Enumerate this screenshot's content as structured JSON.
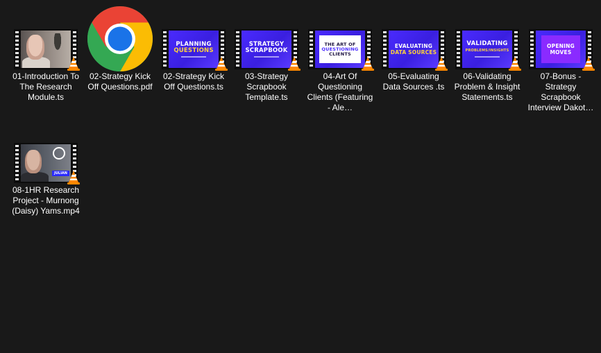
{
  "files": [
    {
      "label": "01-Introduction To The Research Module.ts"
    },
    {
      "label": "02-Strategy Kick Off Questions.pdf"
    },
    {
      "label": "02-Strategy Kick Off Questions.ts",
      "thumb_a": "PLANNING",
      "thumb_b": "QUESTIONS"
    },
    {
      "label": "03-Strategy Scrapbook Template.ts",
      "thumb_a": "STRATEGY",
      "thumb_b": "SCRAPBOOK"
    },
    {
      "label": "04-Art Of Questioning Clients (Featuring - Ale…",
      "thumb_a": "THE ART OF",
      "thumb_b": "QUESTIONING",
      "thumb_c": "CLIENTS"
    },
    {
      "label": "05-Evaluating Data Sources .ts",
      "thumb_a": "EVALUATING",
      "thumb_b": "DATA SOURCES"
    },
    {
      "label": "06-Validating Problem & Insight Statements.ts",
      "thumb_a": "VALIDATING",
      "thumb_b": "PROBLEMS/INSIGHTS"
    },
    {
      "label": "07-Bonus - Strategy Scrapbook Interview Dakot…",
      "thumb_a": "OPENING",
      "thumb_b": "MOVES"
    },
    {
      "label": "08-1HR Research Project - Murnong (Daisy) Yams.mp4",
      "thumb_tag": "JULIAN"
    }
  ],
  "icons": {
    "video_type": "vlc-cone-icon",
    "pdf_type": "chrome-icon"
  },
  "colors": {
    "background": "#191919",
    "thumb_purple": "#4a2bff",
    "highlight_yellow": "#ffd23a",
    "vlc_orange": "#ff8800"
  }
}
